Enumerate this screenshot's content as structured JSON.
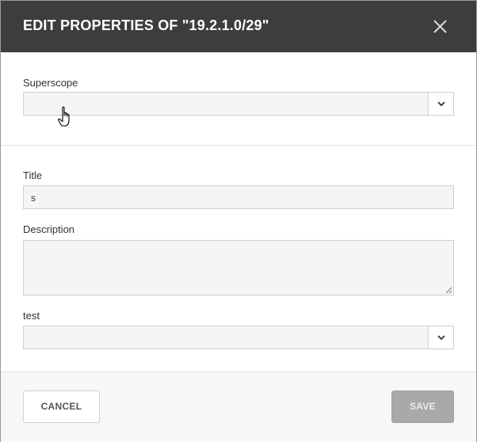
{
  "dialog": {
    "title": "EDIT PROPERTIES OF \"19.2.1.0/29\"",
    "close_icon": "close-icon"
  },
  "superscope": {
    "label": "Superscope",
    "value": "",
    "dropdown_icon": "chevron-down-icon"
  },
  "title_field": {
    "label": "Title",
    "value": "s"
  },
  "description_field": {
    "label": "Description",
    "value": ""
  },
  "test_field": {
    "label": "test",
    "value": "",
    "dropdown_icon": "chevron-down-icon"
  },
  "footer": {
    "cancel_label": "CANCEL",
    "save_label": "SAVE"
  },
  "colors": {
    "header_bg": "#3d3d3d",
    "header_text": "#ffffff",
    "input_bg": "#f5f5f5",
    "save_disabled_bg": "#a9a9a9",
    "footer_bg": "#f7f7f7"
  }
}
